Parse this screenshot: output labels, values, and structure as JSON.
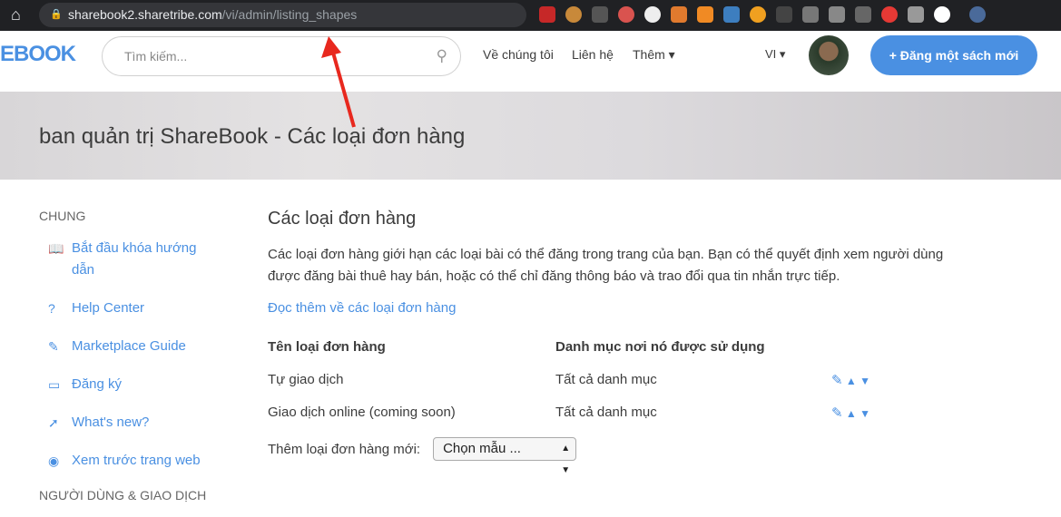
{
  "browser": {
    "url_host": "sharebook2.sharetribe.com",
    "url_path": "/vi/admin/listing_shapes"
  },
  "header": {
    "logo": "EBOOK",
    "search_placeholder": "Tìm kiếm...",
    "nav": [
      "Về chúng tôi",
      "Liên hệ",
      "Thêm ▾"
    ],
    "lang": "VI ▾",
    "post_button": "+ Đăng một sách mới"
  },
  "banner": {
    "title": "ban quản trị ShareBook - Các loại đơn hàng"
  },
  "sidebar": {
    "section1": "CHUNG",
    "items": [
      {
        "icon": "book-icon",
        "glyph": "📖",
        "label": "Bắt đầu khóa hướng dẫn"
      },
      {
        "icon": "help-icon",
        "glyph": "?",
        "label": "Help Center"
      },
      {
        "icon": "guide-icon",
        "glyph": "✎",
        "label": "Marketplace Guide"
      },
      {
        "icon": "card-icon",
        "glyph": "▭",
        "label": "Đăng ký"
      },
      {
        "icon": "rocket-icon",
        "glyph": "➚",
        "label": "What's new?"
      },
      {
        "icon": "eye-icon",
        "glyph": "◉",
        "label": "Xem trước trang web"
      }
    ],
    "section2": "NGƯỜI DÙNG & GIAO DỊCH"
  },
  "main": {
    "title": "Các loại đơn hàng",
    "description": "Các loại đơn hàng giới hạn các loại bài có thể đăng trong trang của bạn. Bạn có thể quyết định xem người dùng được đăng bài thuê hay bán, hoặc có thể chỉ đăng thông báo và trao đổi qua tin nhắn trực tiếp.",
    "read_more": "Đọc thêm về các loại đơn hàng",
    "table": {
      "headers": [
        "Tên loại đơn hàng",
        "Danh mục nơi nó được sử dụng"
      ],
      "rows": [
        [
          "Tự giao dịch",
          "Tất cả danh mục"
        ],
        [
          "Giao dịch online (coming soon)",
          "Tất cả danh mục"
        ]
      ]
    },
    "add_label": "Thêm loại đơn hàng mới:",
    "select_value": "Chọn mẫu ..."
  },
  "colors": {
    "accent": "#4a90e2",
    "annotation": "#e8281e"
  }
}
